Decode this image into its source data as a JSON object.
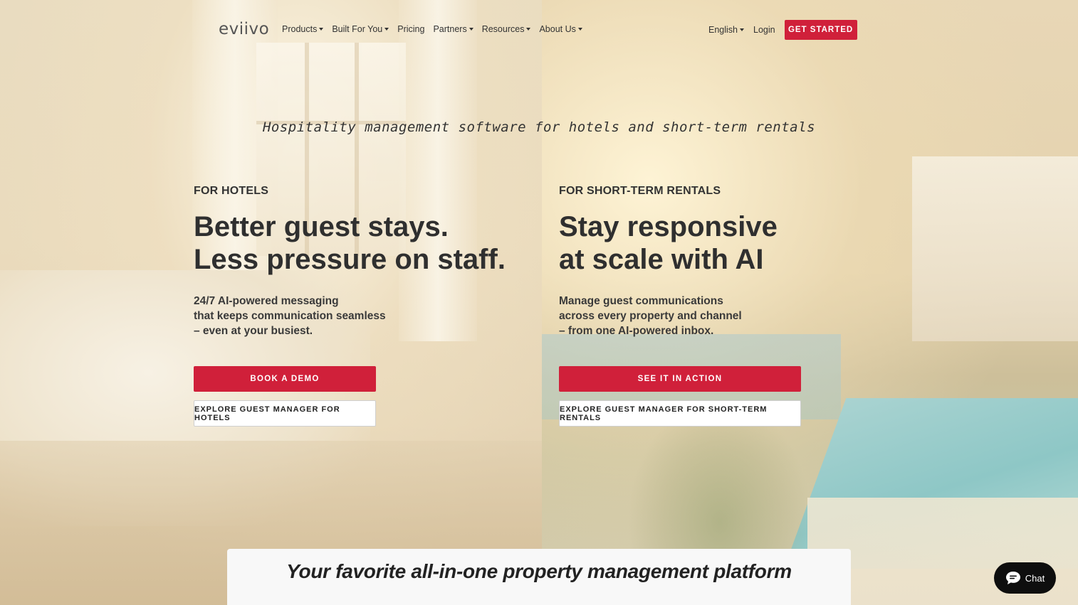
{
  "nav": {
    "logo": "eviivo",
    "menu": [
      {
        "label": "Products",
        "dropdown": true
      },
      {
        "label": "Built For You",
        "dropdown": true
      },
      {
        "label": "Pricing",
        "dropdown": false
      },
      {
        "label": "Partners",
        "dropdown": true
      },
      {
        "label": "Resources",
        "dropdown": true
      },
      {
        "label": "About Us",
        "dropdown": true
      }
    ],
    "language": "English",
    "login": "Login",
    "cta": "GET STARTED"
  },
  "hero": {
    "tagline": "Hospitality management software for hotels and short-term rentals",
    "hotels": {
      "eyebrow": "FOR HOTELS",
      "headline": [
        "Better guest stays.",
        "Less pressure on staff."
      ],
      "body": [
        "24/7 AI-powered messaging",
        "that keeps communication seamless",
        "– even at your busiest."
      ],
      "primary_button": "BOOK A DEMO",
      "secondary_button": "EXPLORE GUEST MANAGER FOR HOTELS"
    },
    "rentals": {
      "eyebrow": "FOR SHORT-TERM RENTALS",
      "headline": [
        "Stay responsive",
        "at scale with AI"
      ],
      "body": [
        "Manage guest communications",
        "across every property and channel",
        "– from one AI-powered inbox."
      ],
      "primary_button": "SEE IT IN ACTION",
      "secondary_button": "EXPLORE GUEST MANAGER FOR SHORT-TERM RENTALS"
    }
  },
  "platform": {
    "title": "Your favorite all-in-one property management platform"
  },
  "chat": {
    "label": "Chat",
    "icon": "chat-bubble-icon"
  },
  "colors": {
    "accent": "#d0203a",
    "chat_bg": "#0e0e0e"
  }
}
